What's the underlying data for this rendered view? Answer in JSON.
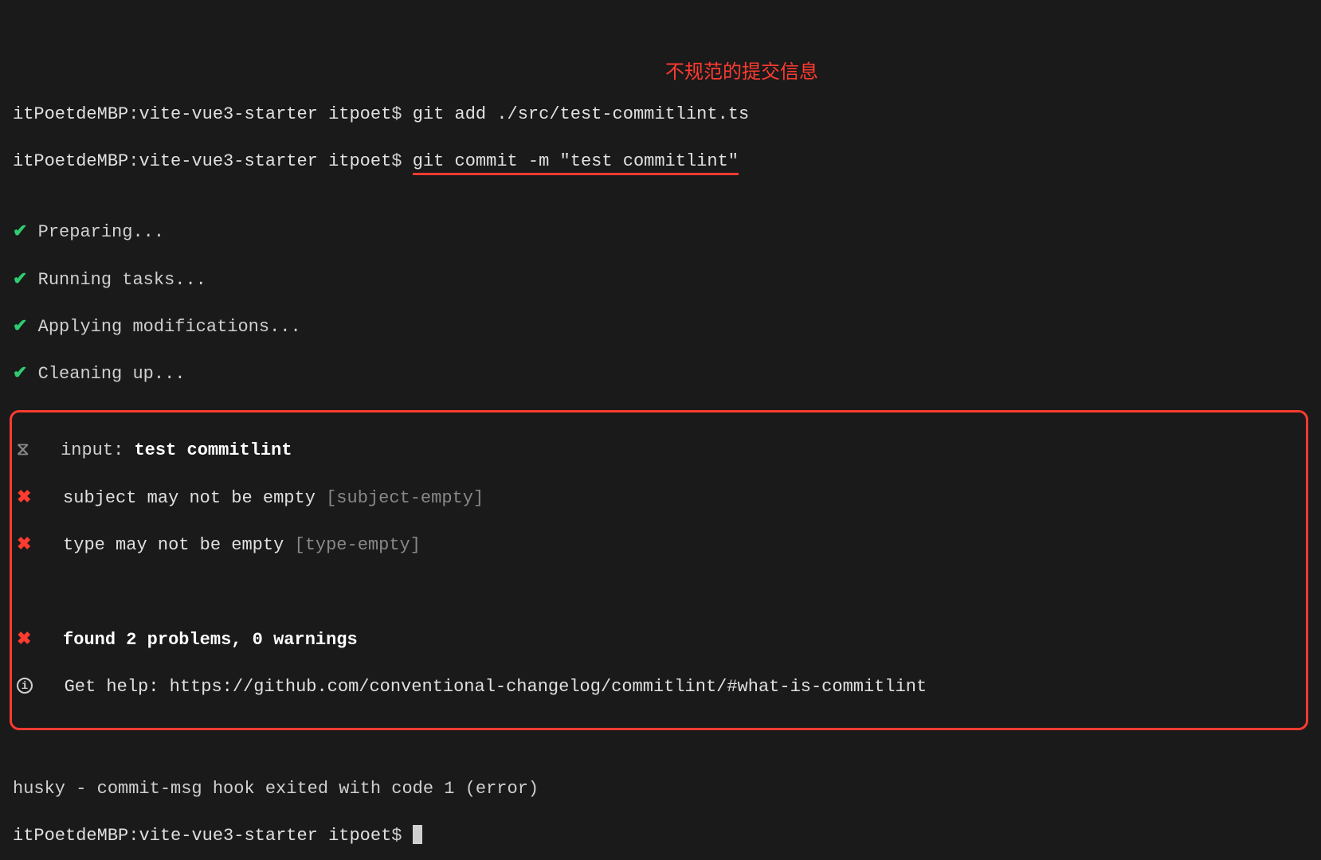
{
  "prompt": {
    "host": "itPoetdeMBP",
    "path": "vite-vue3-starter",
    "user": "itpoet",
    "symbol": "$"
  },
  "commands": {
    "add": "git add ./src/test-commitlint.ts",
    "commit": "git commit -m \"test commitlint\""
  },
  "annotation": "不规范的提交信息",
  "tasks": [
    "Preparing...",
    "Running tasks...",
    "Applying modifications...",
    "Cleaning up..."
  ],
  "commitlint": {
    "input_label": "input:",
    "input_value": "test commitlint",
    "errors": [
      {
        "msg": "subject may not be empty",
        "rule": "[subject-empty]"
      },
      {
        "msg": "type may not be empty",
        "rule": "[type-empty]"
      }
    ],
    "summary": "found 2 problems, 0 warnings",
    "help_label": "Get help:",
    "help_url": "https://github.com/conventional-changelog/commitlint/#what-is-commitlint"
  },
  "husky": "husky - commit-msg hook exited with code 1 (error)",
  "icons": {
    "check": "✔",
    "neutral": "⧖",
    "cross": "✖",
    "info": "i"
  }
}
